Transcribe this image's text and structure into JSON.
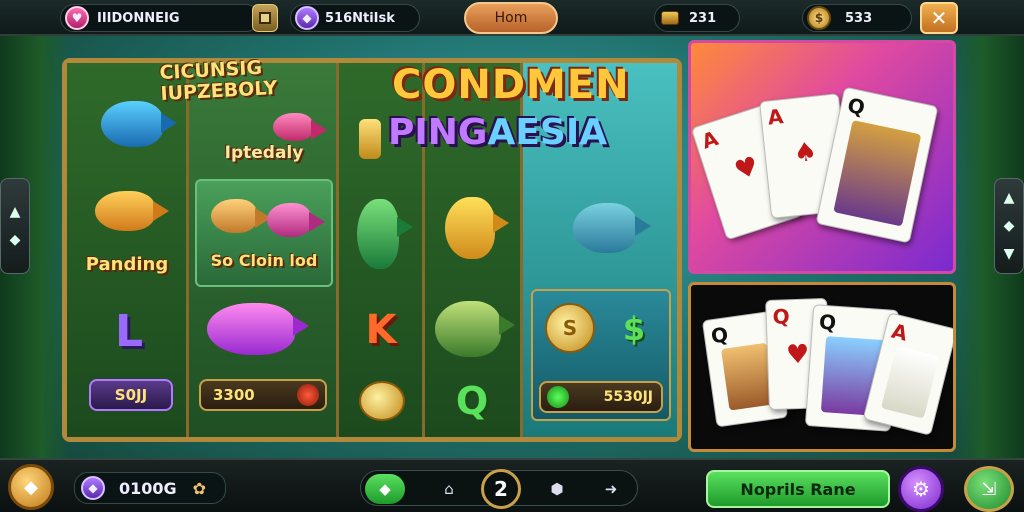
{
  "top_bar": {
    "player_name": "IIIDONNEIG",
    "player_badge_icon": "heart-badge-icon",
    "box_icon": "box-icon",
    "gem_label": "516NtiIsk",
    "home_label": "Hom",
    "coins_value": "231",
    "gold_value": "533",
    "close_label": "✕"
  },
  "board": {
    "promo_heading_line1": "CICUNSIG",
    "promo_heading_line2": "IUPZEBOLY",
    "promo_subtitle": "Iptedaly",
    "label_pending": "Panding",
    "label_bonus": "So Cloin lod",
    "title_line1": "CONDMEN",
    "title_line2_a": "PING",
    "title_line2_b": "AESIA",
    "symbol_l": "L",
    "symbol_k": "K",
    "symbol_q": "Q",
    "symbol_dollar": "$",
    "chip_left": "S0JJ",
    "chip_middle": "3300",
    "chip_right": "5530JJ"
  },
  "cards_top": [
    {
      "rank": "A",
      "suit": "♥"
    },
    {
      "rank": "A",
      "suit": "♠"
    },
    {
      "rank": "Q",
      "suit": "♠"
    }
  ],
  "cards_bottom": [
    {
      "rank": "Q",
      "suit": "♠"
    },
    {
      "rank": "Q",
      "suit": "♥"
    },
    {
      "rank": "Q",
      "suit": "♠"
    },
    {
      "rank": "A",
      "suit": "♥"
    }
  ],
  "bottom_bar": {
    "balance": "0100G",
    "page_number": "2",
    "primary_button": "Noprils Rane"
  },
  "colors": {
    "gold": "#ffc83a",
    "purple": "#c07aff",
    "green_button": "#2ebd3a",
    "panel_border": "#d24aa4"
  }
}
